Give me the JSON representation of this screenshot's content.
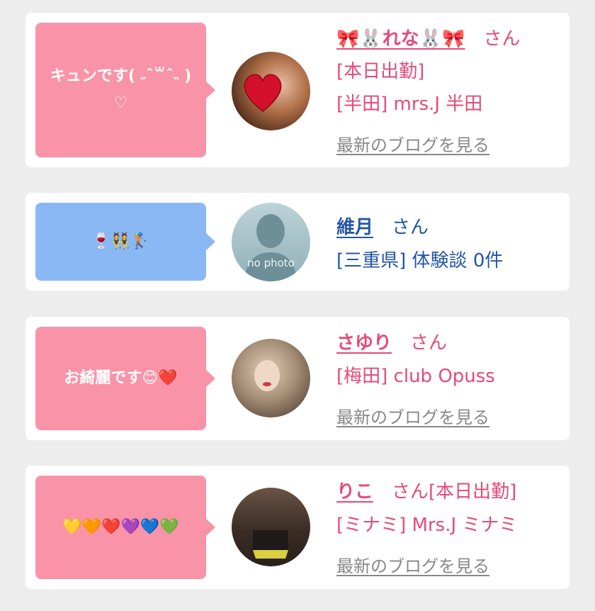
{
  "colors": {
    "pink_bubble": "#f993a8",
    "blue_bubble": "#8ab8f5",
    "pink_text": "#e64a78",
    "blue_text": "#2356a6",
    "link_gray": "#888888",
    "background": "#ededed",
    "card": "#ffffff"
  },
  "posts": [
    {
      "bubble_color": "pink",
      "comment_line1": "キュンです( ˶ˆ꒳ˆ˵ )",
      "comment_line2": "♡",
      "avatar_icon": "heart-sticker-avatar",
      "name_prefix": "🎀🐰",
      "name": "れな",
      "name_suffix": "🐰🎀",
      "honorific": "さん",
      "status": "[本日出勤]",
      "shop": "[半田] mrs.J 半田",
      "blog_link": "最新のブログを見る"
    },
    {
      "bubble_color": "blue",
      "comment": "🍷👯🏌",
      "avatar_icon": "no-photo-avatar",
      "avatar_placeholder": "no photo",
      "name": "維月",
      "honorific": "さん",
      "shop": "[三重県] 体験談 0件"
    },
    {
      "bubble_color": "pink",
      "comment": "お綺麗です😊❤️",
      "avatar_icon": "woman-photo-avatar",
      "name": "さゆり",
      "honorific": "さん",
      "shop": "[梅田] club Opuss",
      "blog_link": "最新のブログを見る"
    },
    {
      "bubble_color": "pink",
      "comment": "💛🧡❤️💜💙💚",
      "avatar_icon": "woman-photo-avatar",
      "name": "りこ",
      "honorific": "さん[本日出勤]",
      "shop": "[ミナミ] Mrs.J ミナミ",
      "blog_link": "最新のブログを見る"
    }
  ]
}
